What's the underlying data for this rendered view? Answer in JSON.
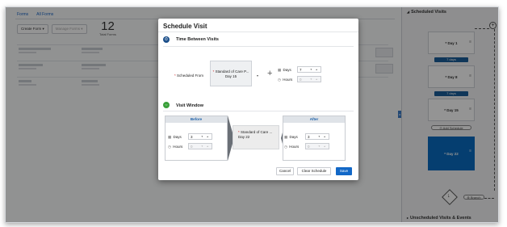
{
  "app": {
    "tabs": [
      "Forms",
      "All Forms"
    ],
    "toolbar": {
      "create_label": "Create Form",
      "manage_label": "Manage Forms"
    },
    "stat": {
      "value": "12",
      "label": "Total Forms"
    }
  },
  "right_panel": {
    "title": "Scheduled Visits",
    "footer": "Unscheduled Visits & Events",
    "visits": [
      {
        "label": "* Day 1",
        "selected": false
      },
      {
        "label": "* Day 8",
        "selected": false
      },
      {
        "label": "* Day 15",
        "selected": false
      },
      {
        "label": "* Day 22",
        "selected": true
      }
    ],
    "intervals": [
      "7 days",
      "7 days"
    ],
    "add_schedule_label": "Add Schedule",
    "branch_label": "Branch"
  },
  "modal": {
    "title": "Schedule Visit",
    "section_time": "Time Between Visits",
    "scheduled_from_label": "Scheduled From",
    "scheduled_from_value_line1": "Standard of Care P...",
    "scheduled_from_value_line2": "Day 15",
    "days_label": "Days",
    "hours_label": "Hours",
    "time_days_value": "7",
    "time_hours_value": "0",
    "section_window": "Visit Window",
    "before_label": "Before",
    "after_label": "After",
    "before_days_value": "3",
    "before_hours_value": "0",
    "after_days_value": "3",
    "after_hours_value": "0",
    "window_center_line1": "Standard of Care ...",
    "window_center_line2": "Day 22",
    "cancel_label": "Cancel",
    "clear_label": "Clear Schedule",
    "save_label": "Save"
  }
}
